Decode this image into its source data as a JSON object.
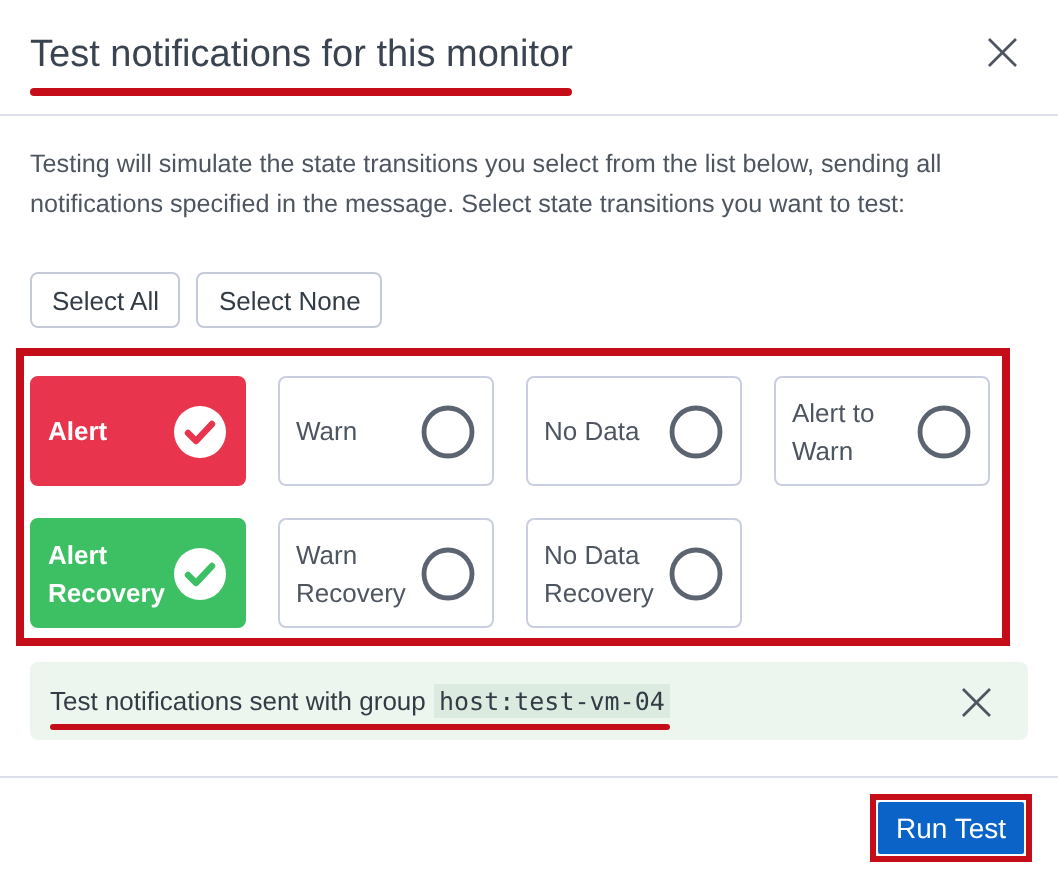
{
  "dialog": {
    "title": "Test notifications for this monitor",
    "title_highlighted": true,
    "close": "×"
  },
  "description": "Testing will simulate the state transitions you select from the list below, sending all notifications specified in the message. Select state transitions you want to test:",
  "selection_buttons": [
    "Select All",
    "Select None"
  ],
  "transitions_highlighted": true,
  "transitions": [
    {
      "label": "Alert",
      "selected": true,
      "color": "#e8354d"
    },
    {
      "label": "Warn",
      "selected": false
    },
    {
      "label": "No Data",
      "selected": false
    },
    {
      "label": "Alert to Warn",
      "selected": false
    },
    {
      "label": "Alert Recovery",
      "selected": true,
      "color": "#3dbf63"
    },
    {
      "label": "Warn Recovery",
      "selected": false
    },
    {
      "label": "No Data Recovery",
      "selected": false
    }
  ],
  "status": {
    "text": "Test notifications sent with group",
    "group": "host:test-vm-04",
    "highlighted": true,
    "close": "×"
  },
  "run_button": {
    "label": "Run Test",
    "highlighted": true
  }
}
